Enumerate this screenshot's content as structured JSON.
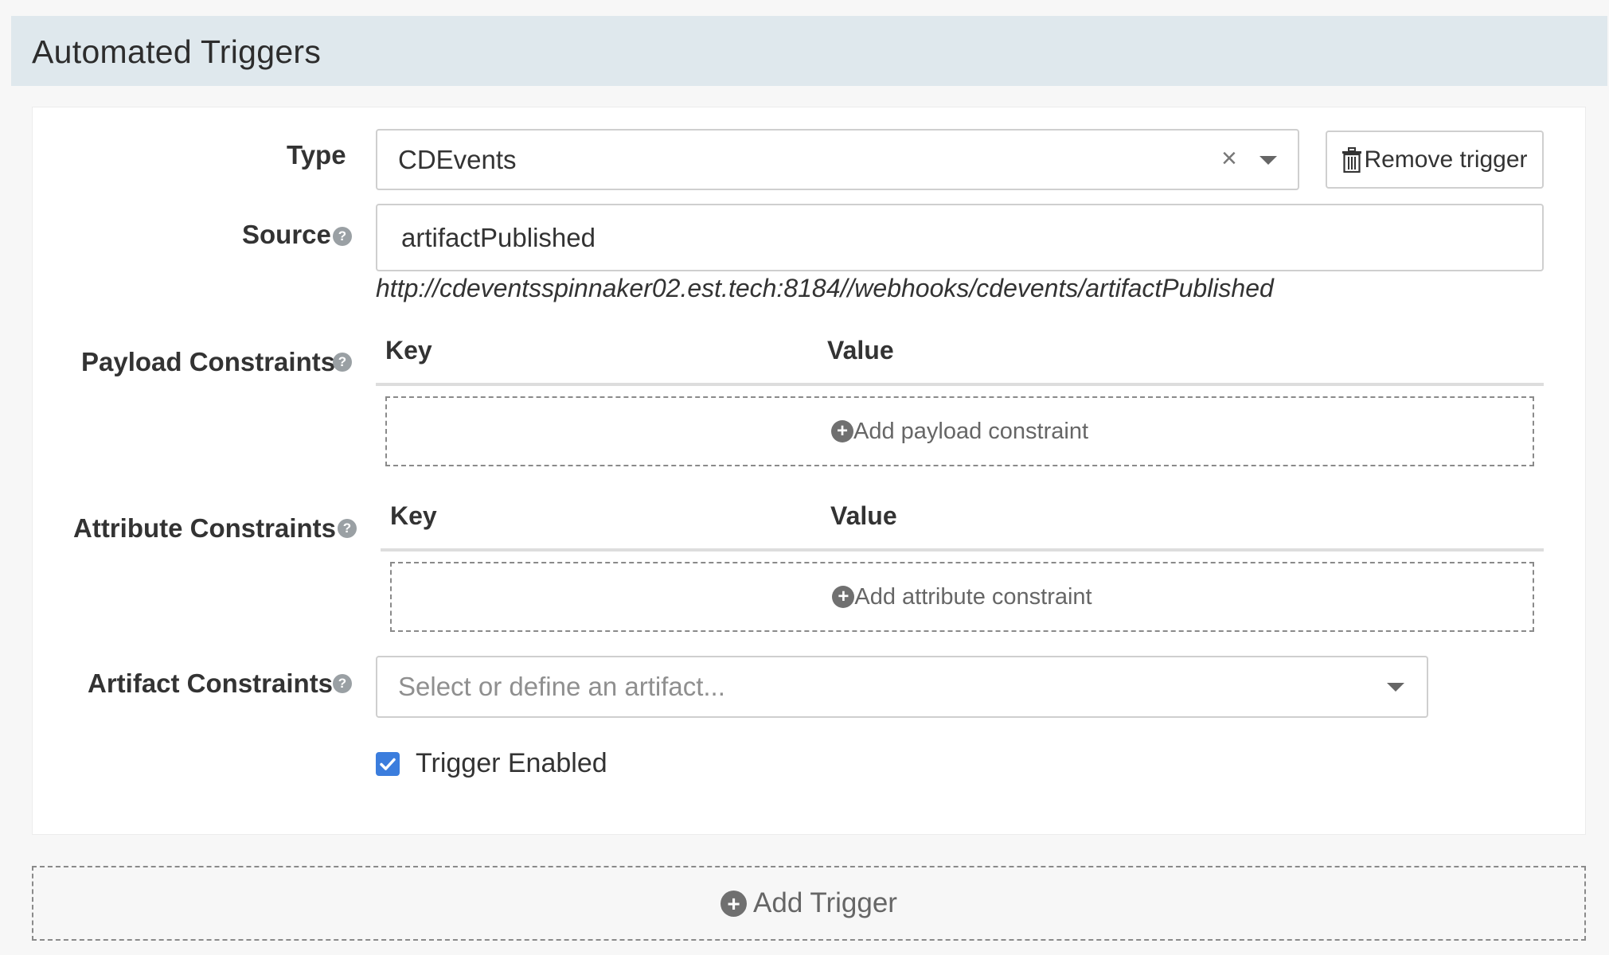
{
  "section": {
    "title": "Automated Triggers"
  },
  "trigger": {
    "type_label": "Type",
    "type_value": "CDEvents",
    "clear_symbol": "×",
    "remove_label": "Remove trigger",
    "source_label": "Source",
    "source_value": "artifactPublished",
    "source_url": "http://cdeventsspinnaker02.est.tech:8184//webhooks/cdevents/artifactPublished",
    "payload": {
      "label": "Payload Constraints",
      "key_header": "Key",
      "value_header": "Value",
      "add_label": "Add payload constraint"
    },
    "attribute": {
      "label": "Attribute Constraints",
      "key_header": "Key",
      "value_header": "Value",
      "add_label": "Add attribute constraint"
    },
    "artifact": {
      "label": "Artifact Constraints",
      "placeholder": "Select or define an artifact..."
    },
    "enabled_label": "Trigger Enabled",
    "enabled": true
  },
  "add_trigger_label": "Add Trigger",
  "help_glyph": "?",
  "plus_glyph": "+",
  "icons": [
    "question-circle-icon",
    "trash-icon",
    "plus-circle-icon",
    "chevron-down-icon",
    "close-icon",
    "checkmark-icon"
  ],
  "colors": {
    "header_bg": "#dfe8ed",
    "checkbox": "#3b7ddd",
    "page_bg": "#f7f7f7"
  }
}
